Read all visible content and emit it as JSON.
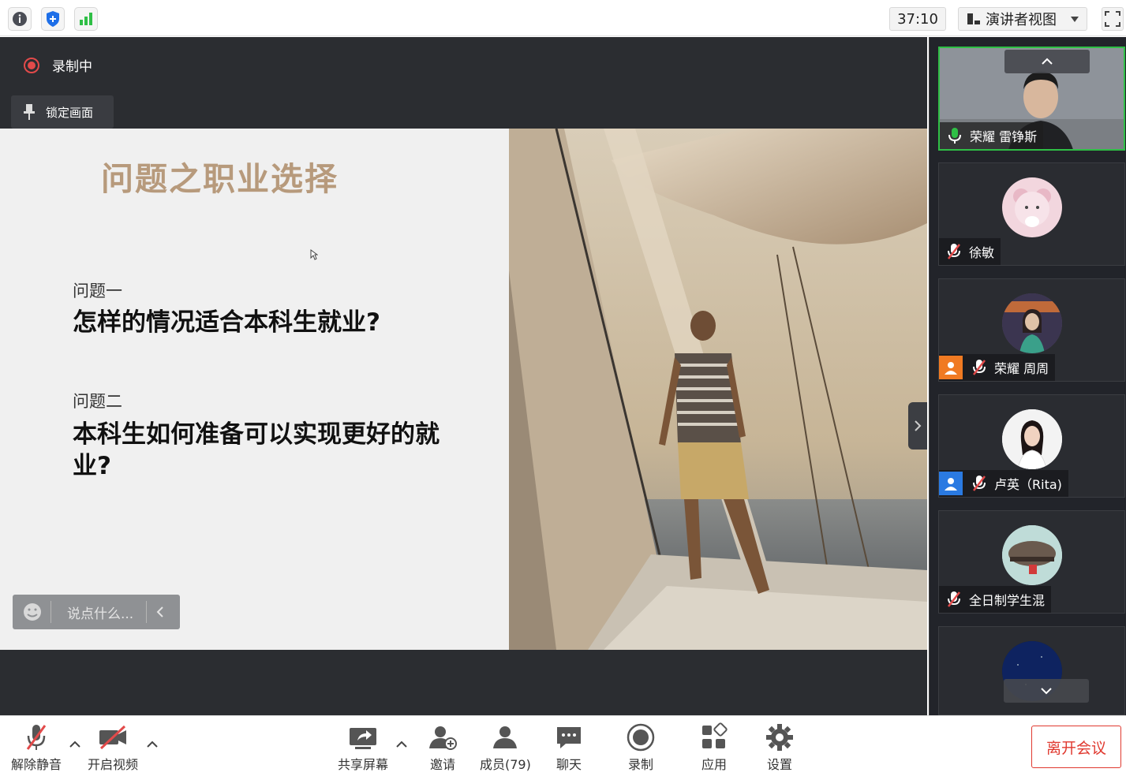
{
  "topbar": {
    "timer": "37:10",
    "view_mode": "演讲者视图",
    "icons": [
      "info-icon",
      "shield-icon",
      "signal-icon",
      "fullscreen-icon"
    ]
  },
  "stage": {
    "recording_label": "录制中",
    "lock_label": "锁定画面",
    "comment_placeholder": "说点什么..."
  },
  "slide": {
    "title": "问题之职业选择",
    "q1_label": "问题一",
    "q1_text": "怎样的情况适合本科生就业?",
    "q2_label": "问题二",
    "q2_text": "本科生如何准备可以实现更好的就业?"
  },
  "participants": [
    {
      "name": "荣耀 雷铮斯",
      "speaking": true
    },
    {
      "name": "徐敏",
      "muted": true
    },
    {
      "name": "荣耀 周周",
      "muted": true
    },
    {
      "name": "卢英（Rita)",
      "muted": true
    },
    {
      "name": "全日制学生混",
      "muted": true
    }
  ],
  "toolbar": {
    "unmute": "解除静音",
    "video": "开启视频",
    "share": "共享屏幕",
    "invite": "邀请",
    "members": "成员(79)",
    "chat": "聊天",
    "record": "录制",
    "apps": "应用",
    "settings": "设置",
    "leave": "离开会议"
  },
  "colors": {
    "accent_green": "#2fbf46",
    "record_red": "#e24a4a",
    "leave_red": "#e0392f",
    "title_gold": "#b79a7c"
  }
}
